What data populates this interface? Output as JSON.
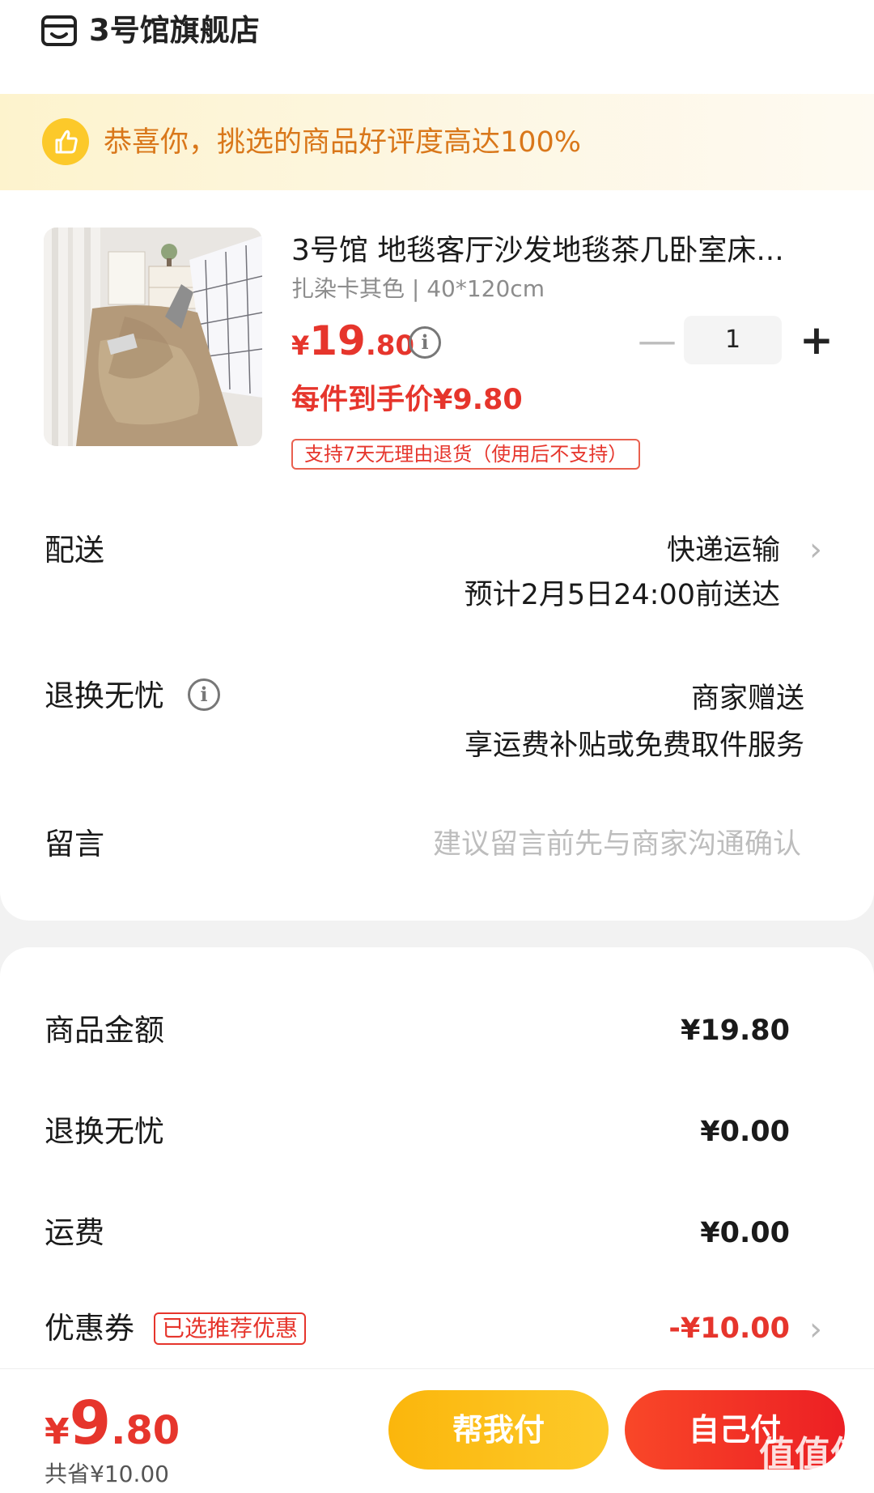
{
  "header": {
    "store_name": "3号馆旗舰店",
    "icon": "store-icon"
  },
  "banner": {
    "text": "恭喜你，挑选的商品好评度高达100%",
    "icon": "thumbs-up-icon"
  },
  "product": {
    "title": "3号馆 地毯客厅沙发地毯茶几卧室床...",
    "spec": "扎染卡其色 | 40*120cm",
    "price_yen": "¥",
    "price_int": "19",
    "price_dec": ".80",
    "quantity": "1",
    "unit_price": "每件到手价¥9.80",
    "return_policy": "支持7天无理由退货（使用后不支持）"
  },
  "delivery": {
    "label": "配送",
    "method": "快递运输",
    "eta": "预计2月5日24:00前送达"
  },
  "return_service": {
    "label": "退换无忧",
    "value": "商家赠送",
    "desc": "享运费补贴或免费取件服务"
  },
  "message": {
    "label": "留言",
    "placeholder": "建议留言前先与商家沟通确认"
  },
  "summary": {
    "goods_label": "商品金额",
    "goods_value": "¥19.80",
    "return_label": "退换无忧",
    "return_value": "¥0.00",
    "shipping_label": "运费",
    "shipping_value": "¥0.00",
    "coupon_label": "优惠券",
    "coupon_tag": "已选推荐优惠",
    "coupon_value": "-¥10.00"
  },
  "footer": {
    "total_yen": "¥",
    "total_int": "9",
    "total_dec": ".80",
    "saved": "共省¥10.00",
    "help_pay": "帮我付",
    "self_pay": "自己付",
    "watermark": "值值值",
    "watermark_url": "zhizhizhi.com"
  },
  "colors": {
    "accent": "#e6352c",
    "banner_text": "#d9771a",
    "help_btn": "#fbb60c",
    "self_btn": "#f2332a"
  }
}
